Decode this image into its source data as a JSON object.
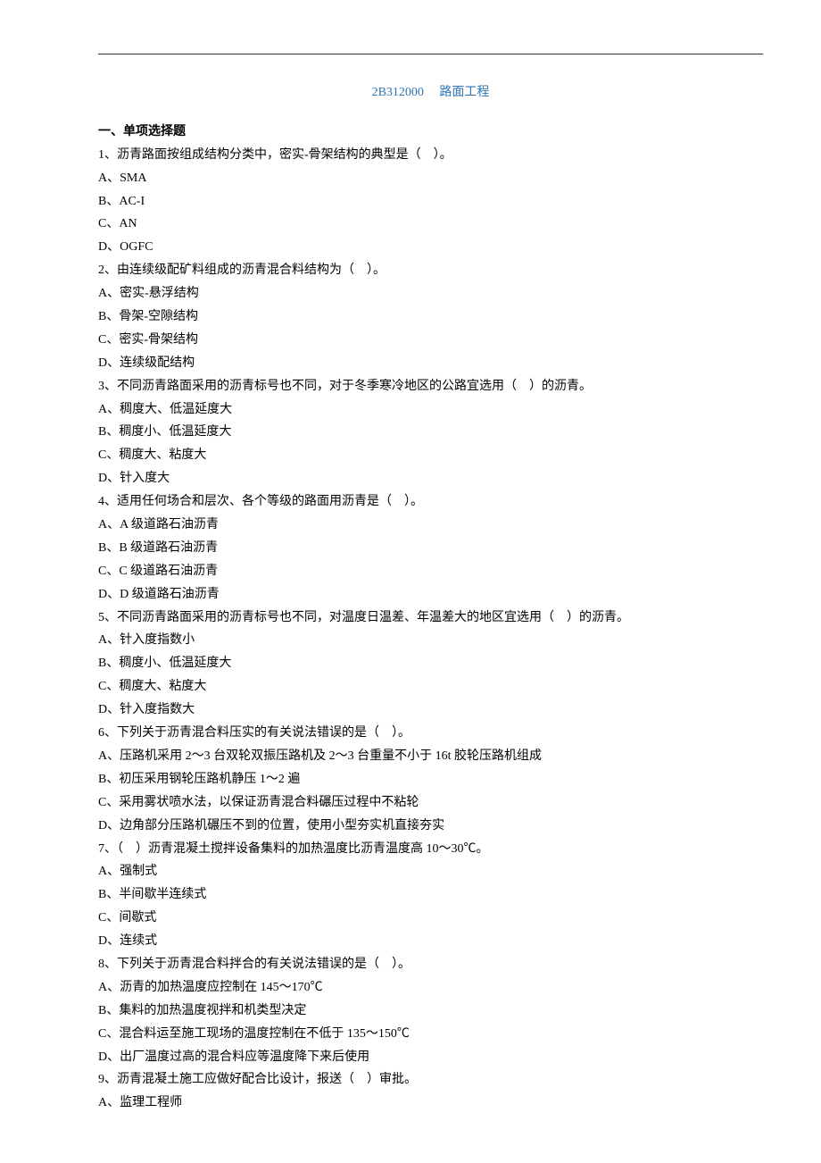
{
  "title": {
    "code": "2B312000",
    "main": "路面工程"
  },
  "section_heading": "一、单项选择题",
  "questions": [
    {
      "q": "1、沥青路面按组成结构分类中，密实-骨架结构的典型是（　）。",
      "opts": [
        "A、SMA",
        "B、AC-I",
        "C、AN",
        "D、OGFC"
      ]
    },
    {
      "q": "2、由连续级配矿料组成的沥青混合料结构为（　）。",
      "opts": [
        "A、密实-悬浮结构",
        "B、骨架-空隙结构",
        "C、密实-骨架结构",
        "D、连续级配结构"
      ]
    },
    {
      "q": "3、不同沥青路面采用的沥青标号也不同，对于冬季寒冷地区的公路宜选用（　）的沥青。",
      "opts": [
        "A、稠度大、低温延度大",
        "B、稠度小、低温延度大",
        "C、稠度大、粘度大",
        "D、针入度大"
      ]
    },
    {
      "q": "4、适用任何场合和层次、各个等级的路面用沥青是（　）。",
      "opts": [
        "A、A 级道路石油沥青",
        "B、B 级道路石油沥青",
        "C、C 级道路石油沥青",
        "D、D 级道路石油沥青"
      ]
    },
    {
      "q": "5、不同沥青路面采用的沥青标号也不同，对温度日温差、年温差大的地区宜选用（　）的沥青。",
      "opts": [
        "A、针入度指数小",
        "B、稠度小、低温延度大",
        "C、稠度大、粘度大",
        "D、针入度指数大"
      ]
    },
    {
      "q": "6、下列关于沥青混合料压实的有关说法错误的是（　）。",
      "opts": [
        "A、压路机采用 2～3 台双轮双振压路机及 2～3 台重量不小于 16t 胶轮压路机组成",
        "B、初压采用钢轮压路机静压 1～2 遍",
        "C、采用雾状喷水法，以保证沥青混合料碾压过程中不粘轮",
        "D、边角部分压路机碾压不到的位置，使用小型夯实机直接夯实"
      ]
    },
    {
      "q": "7、（　）沥青混凝土搅拌设备集料的加热温度比沥青温度高 10～30℃。",
      "opts": [
        "A、强制式",
        "B、半间歇半连续式",
        "C、间歇式",
        "D、连续式"
      ]
    },
    {
      "q": "8、下列关于沥青混合料拌合的有关说法错误的是（　）。",
      "opts": [
        "A、沥青的加热温度应控制在 145～170℃",
        "B、集料的加热温度视拌和机类型决定",
        "C、混合料运至施工现场的温度控制在不低于 135～150℃",
        "D、出厂温度过高的混合料应等温度降下来后使用"
      ]
    },
    {
      "q": "9、沥青混凝土施工应做好配合比设计，报送（　）审批。",
      "opts": [
        "A、监理工程师"
      ]
    }
  ]
}
